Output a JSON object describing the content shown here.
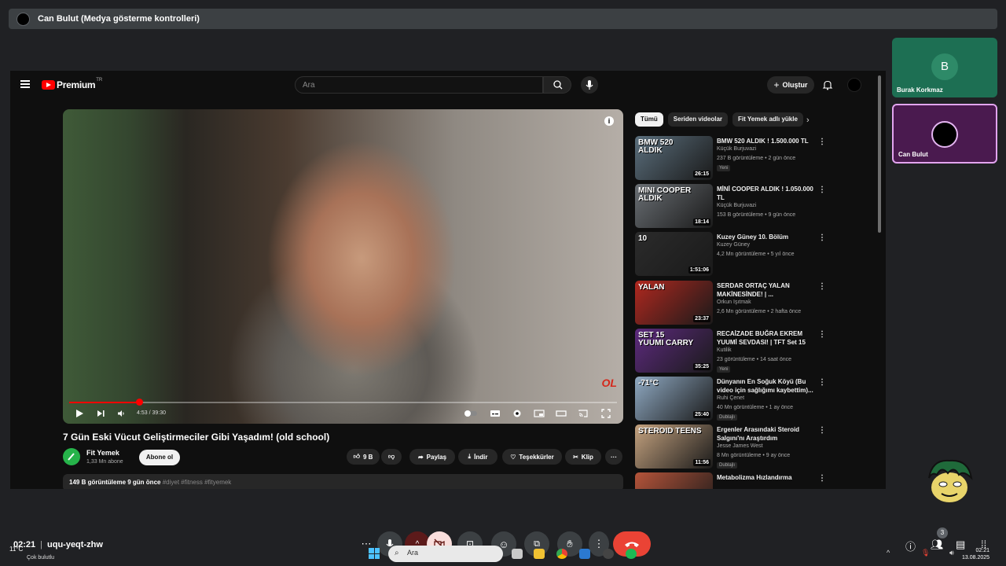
{
  "presenter_bar": {
    "title": "Can Bulut (Medya gösterme kontrolleri)"
  },
  "youtube": {
    "logo_text": "Premium",
    "logo_tm": "TR",
    "search_placeholder": "Ara",
    "create_label": "Oluştur",
    "video": {
      "progress": 0.128,
      "time": "4:53 / 39:30",
      "badge": "OL",
      "title": "7 Gün Eski Vücut Geliştirmeciler Gibi Yaşadım! (old school)"
    },
    "channel": {
      "name": "Fit Yemek",
      "subs": "1,33 Mn abone",
      "subscribe_label": "Abone ol"
    },
    "actions": {
      "likes": "9 B",
      "share": "Paylaş",
      "download": "İndir",
      "thanks": "Teşekkürler",
      "clip": "Klip",
      "more": "···"
    },
    "description": {
      "views_date": "149 B görüntüleme  9 gün önce",
      "tags": "#diyet #fitness #fityemek"
    },
    "chips": [
      "Tümü",
      "Seriden videolar",
      "Fit Yemek adlı yükle"
    ],
    "recommendations": [
      {
        "title": "BMW 520 ALDIK ! 1.500.000 TL",
        "channel": "Küçük Burjuvazi",
        "meta": "237 B görüntüleme • 2 gün önce",
        "badge": "Yeni",
        "duration": "26:15",
        "thumb_text": "BMW 520\nALDIK",
        "thumb_color": "#5b6f7d"
      },
      {
        "title": "MİNİ COOPER ALDIK ! 1.050.000 TL",
        "channel": "Küçük Burjuvazi",
        "meta": "153 B görüntüleme • 9 gün önce",
        "badge": "",
        "duration": "18:14",
        "thumb_text": "MINI COOPER\nALDIK",
        "thumb_color": "#6a6f74"
      },
      {
        "title": "Kuzey Güney 10. Bölüm",
        "channel": "Kuzey Güney",
        "meta": "4,2 Mn görüntüleme • 5 yıl önce",
        "badge": "",
        "duration": "1:51:06",
        "thumb_text": "10",
        "thumb_color": "#2b2b2b"
      },
      {
        "title": "SERDAR ORTAÇ YALAN MAKİNESİNDE! | ...",
        "channel": "Orkun Işıtmak",
        "meta": "2,6 Mn görüntüleme • 2 hafta önce",
        "badge": "",
        "duration": "23:37",
        "thumb_text": "YALAN",
        "thumb_color": "#b0281f"
      },
      {
        "title": "RECAİZADE BUĞRA EKREM YUUMİ SEVDASI! | TFT Set 15",
        "channel": "Kutilik",
        "meta": "23 görüntüleme • 14 saat önce",
        "badge": "Yeni",
        "duration": "35:25",
        "thumb_text": "SET 15\nYUUMI CARRY",
        "thumb_color": "#5d2a7e"
      },
      {
        "title": "Dünyanın En Soğuk Köyü (Bu video için sağlığımı kaybettim)...",
        "channel": "Ruhi Çenet",
        "meta": "40 Mn görüntüleme • 1 ay önce",
        "badge": "Dublajlı",
        "duration": "25:40",
        "thumb_text": "-71°C",
        "thumb_color": "#8fa9c2"
      },
      {
        "title": "Ergenler Arasındaki Steroid Salgını'nı Araştırdım",
        "channel": "Jesse James West",
        "meta": "8 Mn görüntüleme • 9 ay önce",
        "badge": "Dublajlı",
        "duration": "11:56",
        "thumb_text": "STEROID TEENS",
        "thumb_color": "#c4a27f"
      },
      {
        "title": "Metabolizma Hızlandırma",
        "channel": "",
        "meta": "",
        "badge": "",
        "duration": "",
        "thumb_text": "",
        "thumb_color": "#b5543a"
      }
    ]
  },
  "participants": [
    {
      "name": "Burak Korkmaz",
      "initial": "B"
    },
    {
      "name": "Can Bulut",
      "initial": ""
    }
  ],
  "meet": {
    "time": "02:21",
    "code": "uqu-yeqt-zhw",
    "people_count": "3"
  },
  "taskbar": {
    "weather_temp": "11°C",
    "weather_desc": "Çok bulutlu",
    "search_placeholder": "Ara",
    "clock_time": "02:21",
    "clock_date": "13.08.2025"
  }
}
